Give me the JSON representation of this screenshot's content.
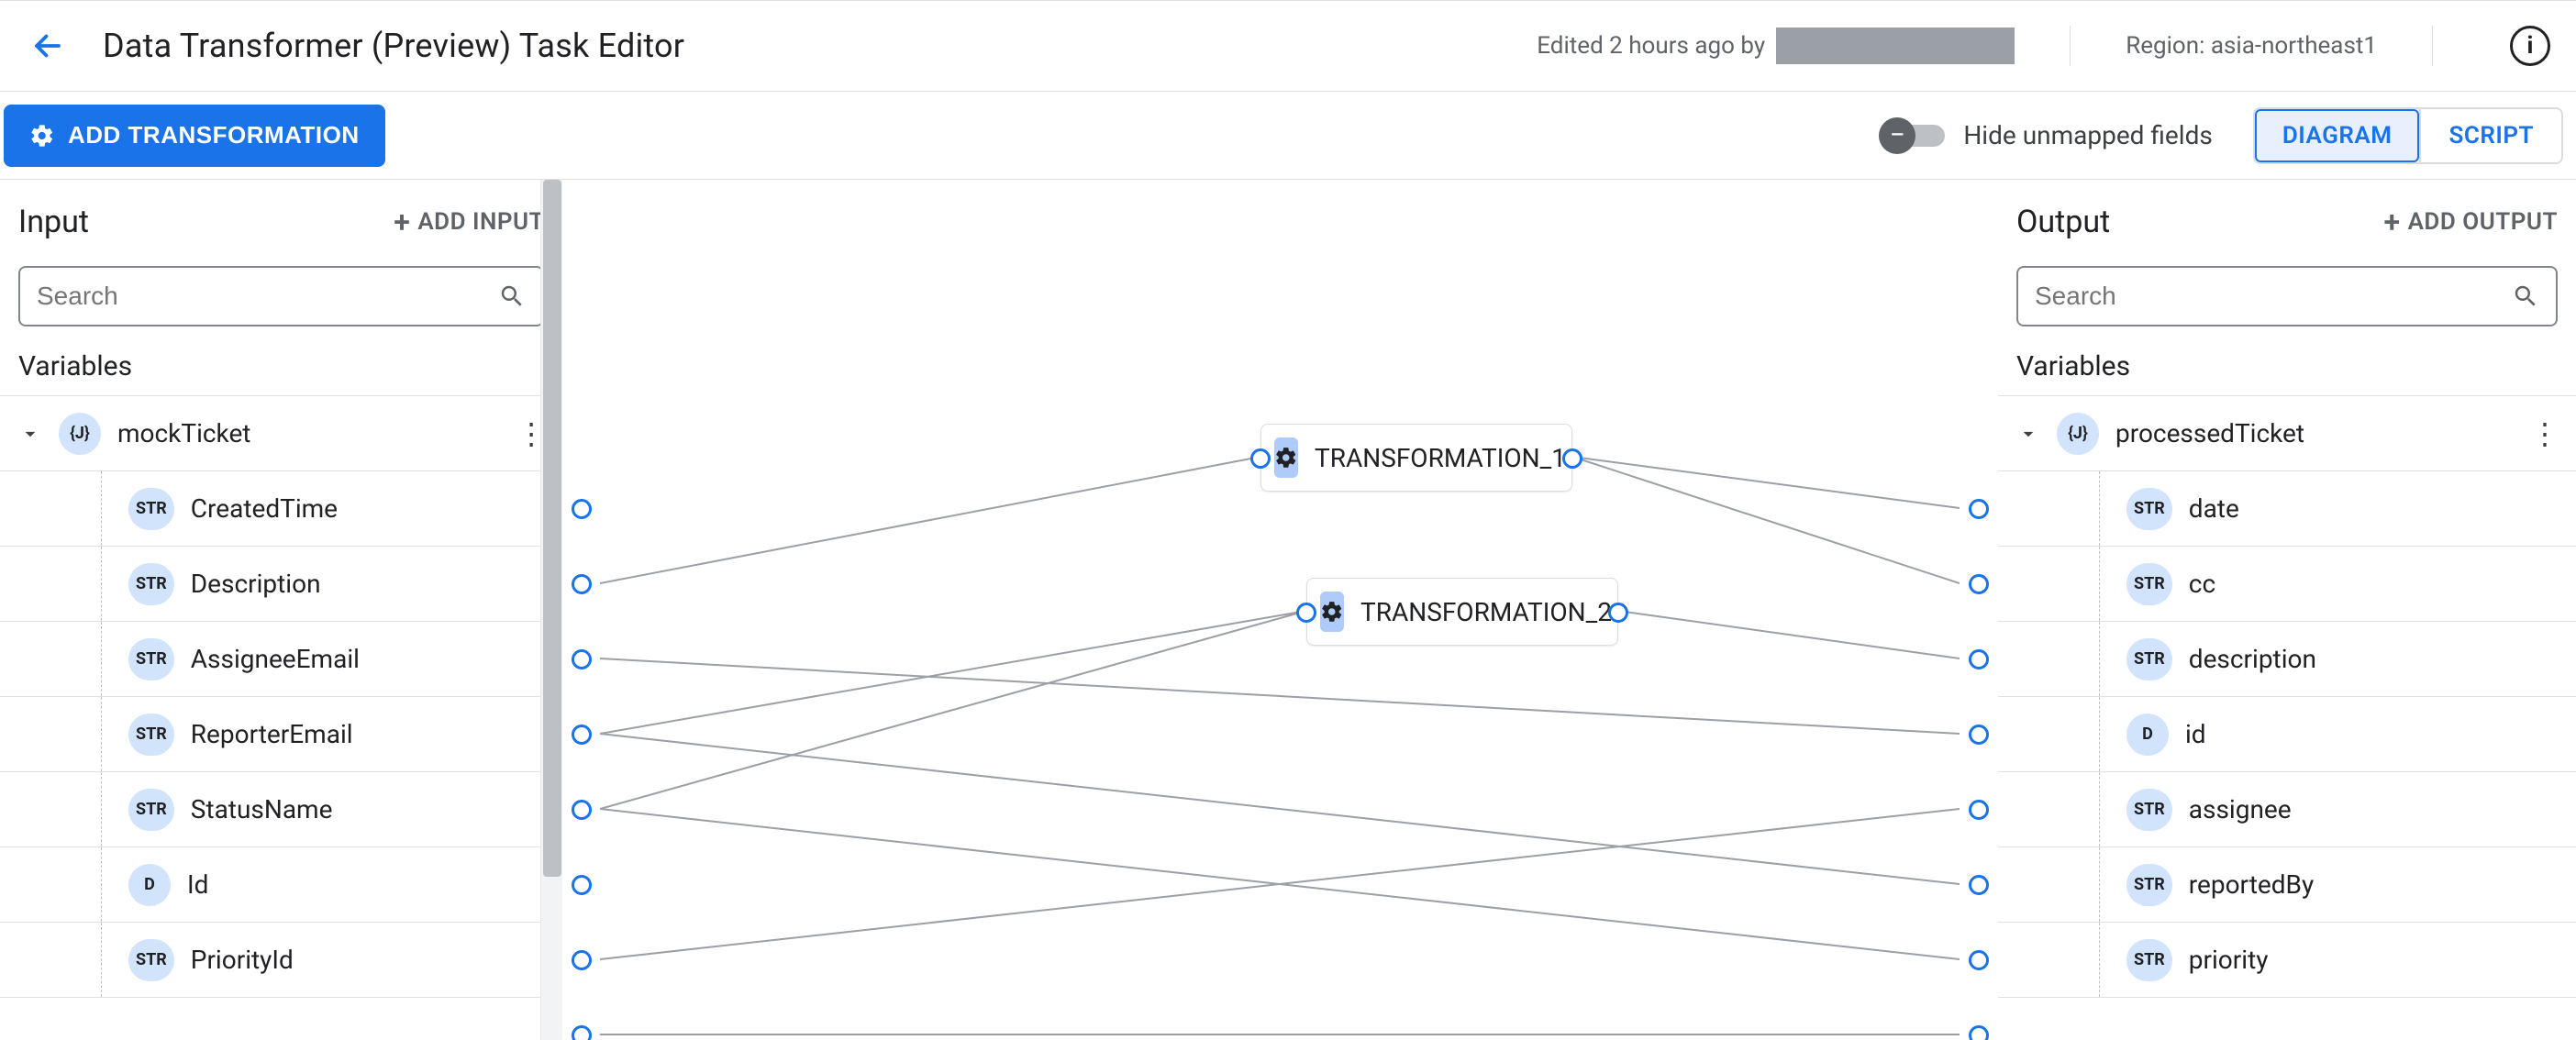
{
  "header": {
    "title": "Data Transformer (Preview) Task Editor",
    "edited_prefix": "Edited 2 hours ago by",
    "region_label": "Region: asia-northeast1"
  },
  "toolbar": {
    "add_transformation_label": "ADD TRANSFORMATION",
    "toggle_label": "Hide unmapped fields",
    "view_tabs": {
      "diagram": "DIAGRAM",
      "script": "SCRIPT"
    }
  },
  "input_panel": {
    "title": "Input",
    "add_label": "ADD INPUT",
    "search_placeholder": "Search",
    "section": "Variables",
    "root": {
      "type": "{J}",
      "name": "mockTicket"
    },
    "fields": [
      {
        "type": "STR",
        "name": "CreatedTime"
      },
      {
        "type": "STR",
        "name": "Description"
      },
      {
        "type": "STR",
        "name": "AssigneeEmail"
      },
      {
        "type": "STR",
        "name": "ReporterEmail"
      },
      {
        "type": "STR",
        "name": "StatusName"
      },
      {
        "type": "D",
        "name": "Id"
      },
      {
        "type": "STR",
        "name": "PriorityId"
      }
    ]
  },
  "output_panel": {
    "title": "Output",
    "add_label": "ADD OUTPUT",
    "search_placeholder": "Search",
    "section": "Variables",
    "root": {
      "type": "{J}",
      "name": "processedTicket"
    },
    "fields": [
      {
        "type": "STR",
        "name": "date"
      },
      {
        "type": "STR",
        "name": "cc"
      },
      {
        "type": "STR",
        "name": "description"
      },
      {
        "type": "D",
        "name": "id"
      },
      {
        "type": "STR",
        "name": "assignee"
      },
      {
        "type": "STR",
        "name": "reportedBy"
      },
      {
        "type": "STR",
        "name": "priority"
      }
    ]
  },
  "canvas": {
    "nodes": [
      {
        "id": "t1",
        "label": "TRANSFORMATION_1"
      },
      {
        "id": "t2",
        "label": "TRANSFORMATION_2"
      }
    ]
  }
}
